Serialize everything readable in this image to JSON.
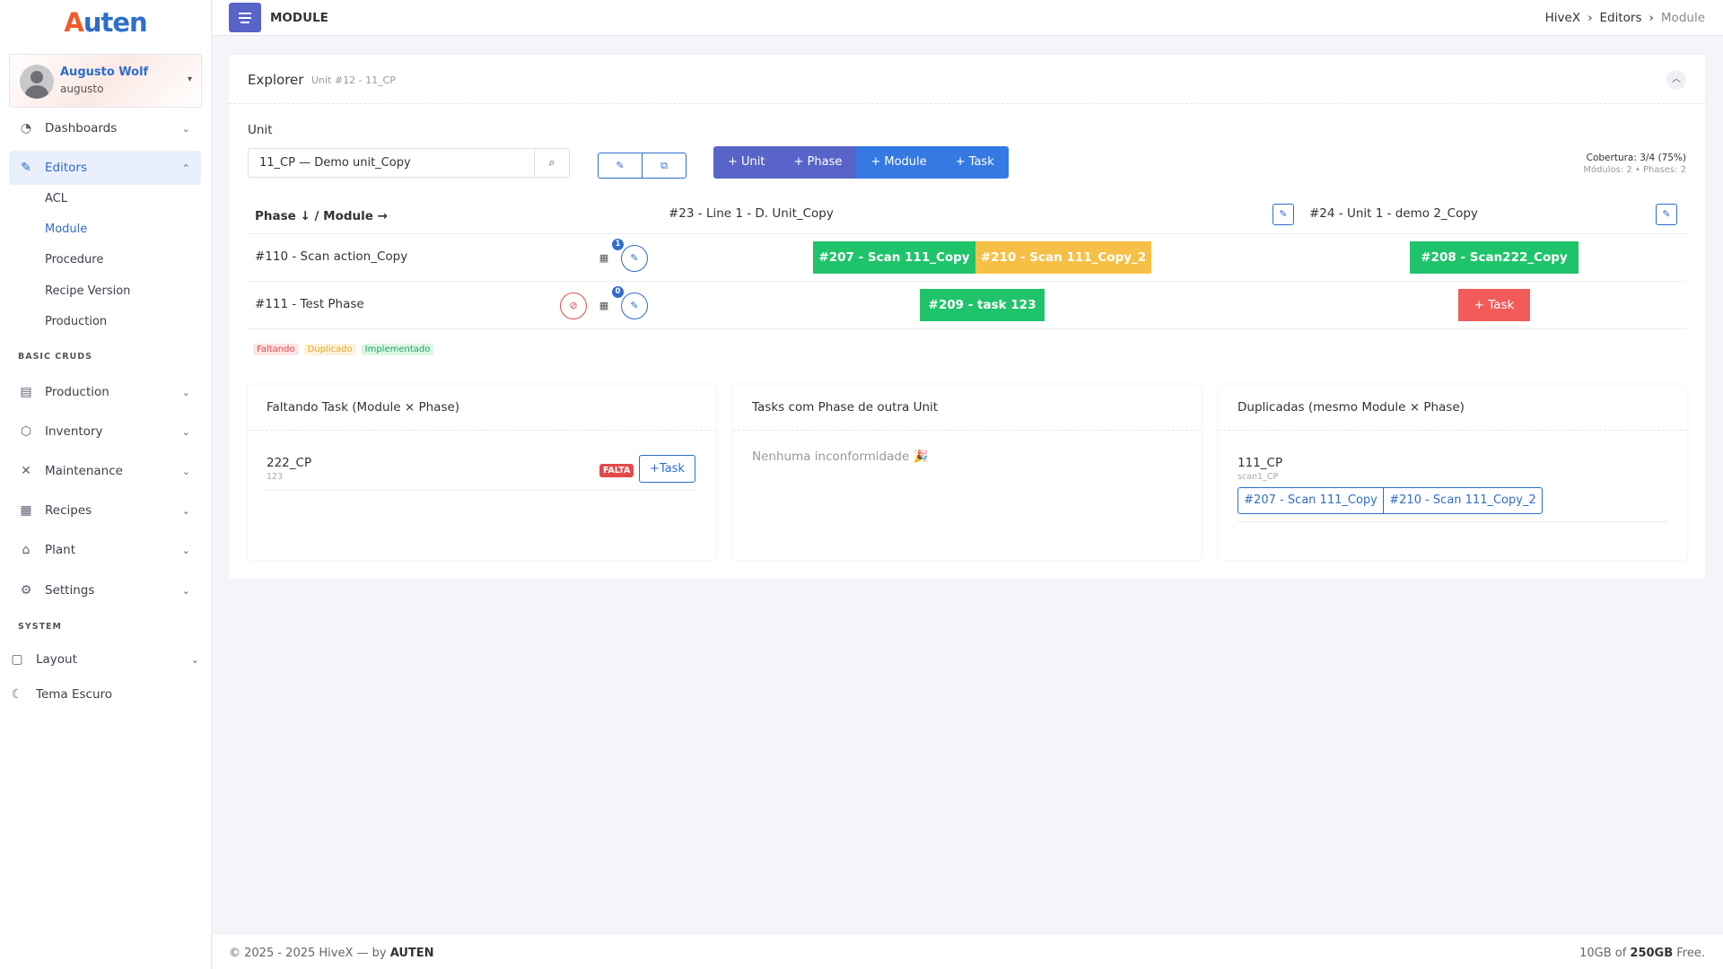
{
  "brand": {
    "logo_a": "A",
    "logo_rest": "uten"
  },
  "user": {
    "name": "Augusto Wolf",
    "login": "augusto"
  },
  "sidebar": {
    "dashboards": "Dashboards",
    "editors": "Editors",
    "editors_sub": [
      "ACL",
      "Module",
      "Procedure",
      "Recipe Version",
      "Production"
    ],
    "section_basic": "BASIC CRUDS",
    "basic": [
      "Production",
      "Inventory",
      "Maintenance",
      "Recipes",
      "Plant",
      "Settings"
    ],
    "section_system": "SYSTEM",
    "layout": "Layout",
    "dark_theme": "Tema Escuro"
  },
  "topbar": {
    "title": "MODULE",
    "breadcrumb": [
      "HiveX",
      "Editors",
      "Module"
    ]
  },
  "explorer": {
    "title": "Explorer",
    "subtitle": "Unit #12 - 11_CP",
    "unit_label": "Unit",
    "unit_value": "11_CP — Demo unit_Copy",
    "buttons": [
      "+ Unit",
      "+ Phase",
      "+ Module",
      "+ Task"
    ],
    "button_colors": [
      "#5864c7",
      "#5864c7",
      "#3579e3",
      "#3579e3"
    ],
    "coverage_line1": "Cobertura: 3/4 (75%)",
    "coverage_line2": "Módulos: 2 • Phases: 2"
  },
  "grid": {
    "corner_header": "Phase ↓ / Module →",
    "modules": [
      "#23 - Line 1 - D. Unit_Copy",
      "#24 - Unit 1 - demo 2_Copy"
    ],
    "rows": [
      {
        "phase": "#110 - Scan action_Copy",
        "badge": "1",
        "cells": [
          [
            {
              "label": "#207 - Scan 111_Copy",
              "status": "green"
            },
            {
              "label": "#210 - Scan 111_Copy_2",
              "status": "yellow"
            }
          ],
          [
            {
              "label": "#208 - Scan222_Copy",
              "status": "green"
            }
          ]
        ]
      },
      {
        "phase": "#111 - Test Phase",
        "badge": "0",
        "cells": [
          [
            {
              "label": "#209 - task 123",
              "status": "green"
            }
          ],
          [
            {
              "label": "+ Task",
              "status": "red"
            }
          ]
        ]
      }
    ]
  },
  "legend": [
    {
      "label": "Faltando",
      "bg": "#fde3e3",
      "fg": "#e24a4a"
    },
    {
      "label": "Duplicado",
      "bg": "#fdf3d9",
      "fg": "#e8a928"
    },
    {
      "label": "Implementado",
      "bg": "#dcf6e6",
      "fg": "#1fa85a"
    }
  ],
  "panels": {
    "missing": {
      "title": "Faltando Task (Module × Phase)",
      "item_main": "222_CP",
      "item_sub": "123",
      "badge": "FALTA",
      "button": "+Task"
    },
    "other_unit": {
      "title": "Tasks com Phase de outra Unit",
      "empty": "Nenhuma inconformidade 🎉"
    },
    "duplicated": {
      "title": "Duplicadas (mesmo Module × Phase)",
      "item_main": "111_CP",
      "item_sub": "scan1_CP",
      "buttons": [
        "#207 - Scan 111_Copy",
        "#210 - Scan 111_Copy_2"
      ]
    }
  },
  "footer": {
    "left_prefix": "© 2025 - 2025 HiveX — by ",
    "left_brand": "AUTEN",
    "right_prefix": "10GB of ",
    "right_bold": "250GB",
    "right_suffix": " Free."
  }
}
